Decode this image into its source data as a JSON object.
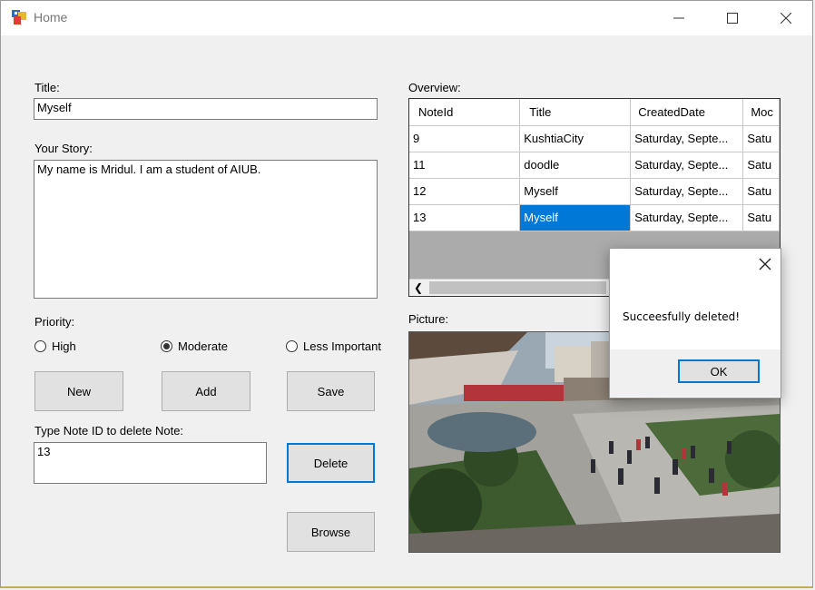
{
  "window": {
    "title": "Home"
  },
  "form": {
    "title_label": "Title:",
    "title_value": "Myself",
    "story_label": "Your Story:",
    "story_value": "My name is Mridul. I am a student of AIUB.",
    "priority_label": "Priority:",
    "priority_options": [
      {
        "label": "High",
        "selected": false
      },
      {
        "label": "Moderate",
        "selected": true
      },
      {
        "label": "Less Important",
        "selected": false
      }
    ],
    "new_label": "New",
    "add_label": "Add",
    "save_label": "Save",
    "delete_id_label": "Type Note ID to delete Note:",
    "delete_id_value": "13",
    "delete_label": "Delete",
    "browse_label": "Browse"
  },
  "overview": {
    "label": "Overview:",
    "columns": [
      "NoteId",
      "Title",
      "CreatedDate",
      "Moc"
    ],
    "rows": [
      [
        "9",
        "KushtiaCity",
        "Saturday, Septe...",
        "Satu"
      ],
      [
        "11",
        "doodle",
        "Saturday, Septe...",
        "Satu"
      ],
      [
        "12",
        "Myself",
        "Saturday, Septe...",
        "Satu"
      ],
      [
        "13",
        "Myself",
        "Saturday, Septe...",
        "Satu"
      ]
    ],
    "scroll_left_icon": "chevron-left-icon"
  },
  "picture": {
    "label": "Picture:"
  },
  "dialog": {
    "message": "Succeesfully deleted!",
    "ok_label": "OK"
  },
  "colors": {
    "accent": "#0078d7",
    "grid_empty": "#ababab"
  }
}
